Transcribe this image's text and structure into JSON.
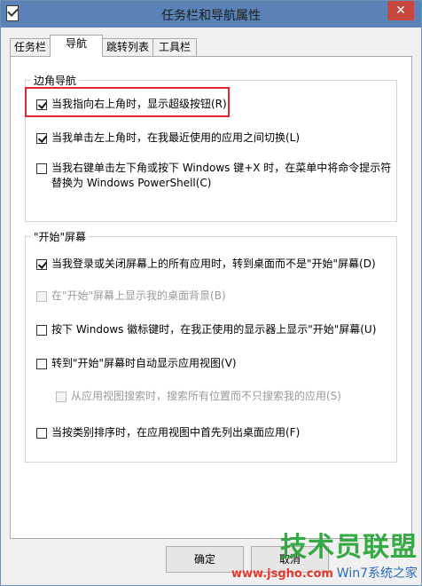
{
  "window": {
    "title": "任务栏和导航属性",
    "close_label": "✕"
  },
  "tabs": [
    {
      "label": "任务栏"
    },
    {
      "label": "导航"
    },
    {
      "label": "跳转列表"
    },
    {
      "label": "工具栏"
    }
  ],
  "corner_nav": {
    "title": "边角导航",
    "options": [
      {
        "label": "当我指向右上角时，显示超级按钮(R)",
        "checked": true
      },
      {
        "label": "当我单击左上角时，在我最近使用的应用之间切换(L)",
        "checked": true
      },
      {
        "label_line1": "当我右键单击左下角或按下 Windows 键+X 时，在菜单中将命令提示符",
        "label_line2": "替换为 Windows PowerShell(C)",
        "checked": false
      }
    ]
  },
  "start_screen": {
    "title": "\"开始\"屏幕",
    "options": [
      {
        "label": "当我登录或关闭屏幕上的所有应用时，转到桌面而不是\"开始\"屏幕(D)",
        "checked": true,
        "enabled": true
      },
      {
        "label": "在\"开始\"屏幕上显示我的桌面背景(B)",
        "checked": false,
        "enabled": false
      },
      {
        "label": "按下 Windows 徽标键时，在我正使用的显示器上显示\"开始\"屏幕(U)",
        "checked": false,
        "enabled": true
      },
      {
        "label": "转到\"开始\"屏幕时自动显示应用视图(V)",
        "checked": false,
        "enabled": true
      },
      {
        "label": "从应用视图搜索时，搜索所有位置而不只搜索我的应用(S)",
        "checked": false,
        "enabled": false
      },
      {
        "label": "当按类别排序时，在应用视图中首先列出桌面应用(F)",
        "checked": false,
        "enabled": true
      }
    ]
  },
  "buttons": {
    "ok": "确定",
    "cancel": "取消"
  },
  "watermark": {
    "main": "技术员联盟",
    "url": "www.jsgho.com",
    "suffix": "Win7系统之家"
  }
}
